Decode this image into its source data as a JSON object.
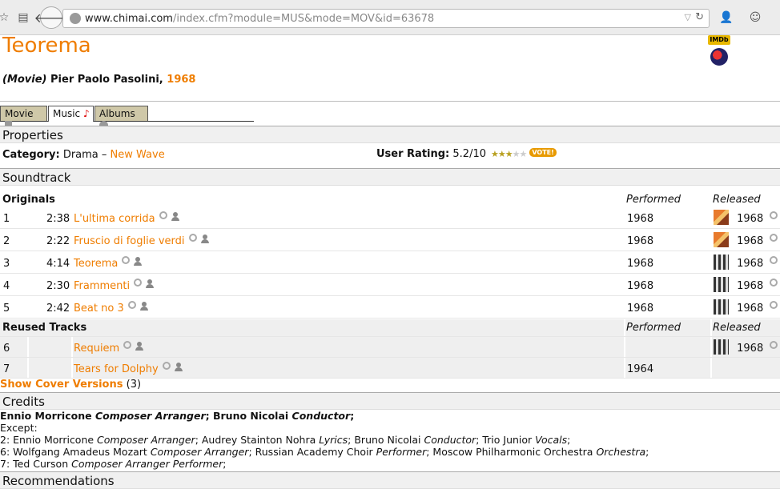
{
  "browser": {
    "url_domain": "www.chimai.com",
    "url_path": "/index.cfm?module=MUS&mode=MOV&id=63678"
  },
  "header": {
    "title": "Teorema",
    "type": "(Movie)",
    "director": "Pier Paolo Pasolini,",
    "year": "1968",
    "imdb": "IMDb"
  },
  "tabs": [
    {
      "label": "Movie"
    },
    {
      "label": "Music"
    },
    {
      "label": "Albums"
    }
  ],
  "properties": {
    "heading": "Properties",
    "category_label": "Category:",
    "category_value": "Drama –",
    "category_link": "New Wave",
    "rating_label": "User Rating:",
    "rating_value": "5.2/10",
    "rating_stars": 3,
    "vote": "VOTE!"
  },
  "soundtrack": {
    "heading": "Soundtrack",
    "originals_label": "Originals",
    "reused_label": "Reused Tracks",
    "performed_label": "Performed",
    "released_label": "Released",
    "originals": [
      {
        "num": "1",
        "time": "2:38",
        "title": "L'ultima corrida",
        "performed": "1968",
        "released": "1968",
        "cover": "c1"
      },
      {
        "num": "2",
        "time": "2:22",
        "title": "Fruscio di foglie verdi",
        "performed": "1968",
        "released": "1968",
        "cover": "c1"
      },
      {
        "num": "3",
        "time": "4:14",
        "title": "Teorema",
        "performed": "1968",
        "released": "1968",
        "cover": "c2"
      },
      {
        "num": "4",
        "time": "2:30",
        "title": "Frammenti",
        "performed": "1968",
        "released": "1968",
        "cover": "c2"
      },
      {
        "num": "5",
        "time": "2:42",
        "title": "Beat no 3",
        "performed": "1968",
        "released": "1968",
        "cover": "c2"
      }
    ],
    "reused": [
      {
        "num": "6",
        "title": "Requiem",
        "performed": "",
        "released": "1968",
        "cover": "c2"
      },
      {
        "num": "7",
        "title": "Tears for Dolphy",
        "performed": "1964",
        "released": "",
        "cover": ""
      }
    ],
    "show_cover_link": "Show Cover Versions",
    "show_cover_count": "(3)"
  },
  "credits": {
    "heading": "Credits",
    "main": {
      "p1": "Ennio Morricone",
      "r1": "Composer Arranger",
      "p2": "Bruno Nicolai",
      "r2": "Conductor"
    },
    "except": "Except:",
    "lines": [
      "2: Ennio Morricone <i>Composer Arranger</i>; Audrey Stainton Nohra <i>Lyrics</i>; Bruno Nicolai <i>Conductor</i>; Trio Junior <i>Vocals</i>;",
      "6: Wolfgang Amadeus Mozart <i>Composer Arranger</i>; Russian Academy Choir <i>Performer</i>; Moscow Philharmonic Orchestra <i>Orchestra</i>;",
      "7: Ted Curson <i>Composer Arranger Performer</i>;"
    ]
  },
  "recommendations": {
    "heading": "Recommendations"
  }
}
